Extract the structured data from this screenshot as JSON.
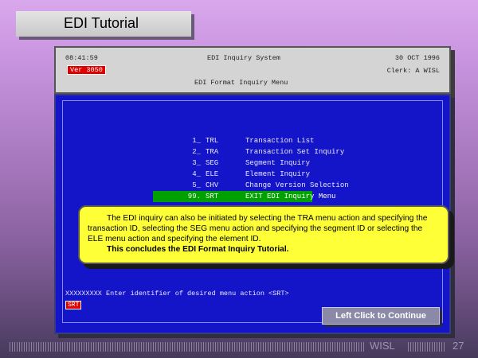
{
  "banner": {
    "title": "EDI Tutorial"
  },
  "header": {
    "time": "08:41:59",
    "system": "EDI Inquiry System",
    "date": "30 OCT 1996",
    "version": "Ver 3050",
    "clerk": "Clerk: A WISL",
    "menu_title": "EDI Format Inquiry Menu"
  },
  "menu": {
    "items": [
      {
        "num": "1_",
        "code": "TRL",
        "label": "Transaction List"
      },
      {
        "num": "2_",
        "code": "TRA",
        "label": "Transaction Set Inquiry"
      },
      {
        "num": "3_",
        "code": "SEG",
        "label": "Segment Inquiry"
      },
      {
        "num": "4_",
        "code": "ELE",
        "label": "Element Inquiry"
      },
      {
        "num": "5_",
        "code": "CHV",
        "label": "Change Version Selection"
      },
      {
        "num": "99.",
        "code": "SRT",
        "label": "EXIT EDI Inquiry Menu"
      }
    ],
    "selected_index": 5
  },
  "prompt": {
    "text": "XXXXXXXXX Enter identifier of desired menu action <SRT>",
    "value": "SRT"
  },
  "callout": {
    "paragraph": "The EDI inquiry can also be initiated by selecting the TRA menu action and specifying the transaction ID, selecting the SEG menu action and specifying the segment ID or selecting the ELE menu action and specifying the element ID.",
    "conclusion": "This concludes the EDI Format Inquiry Tutorial."
  },
  "continue_button": {
    "label": "Left Click to Continue"
  },
  "footer": {
    "brand": "WISL",
    "page": "27"
  }
}
